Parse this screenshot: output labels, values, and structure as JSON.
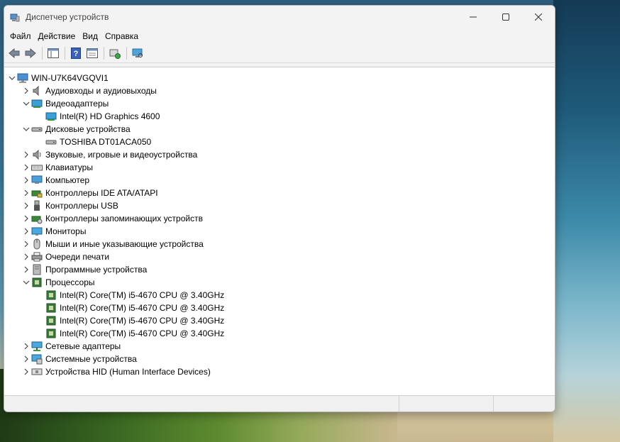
{
  "window": {
    "title": "Диспетчер устройств"
  },
  "menu": [
    "Файл",
    "Действие",
    "Вид",
    "Справка"
  ],
  "tree": {
    "root": "WIN-U7K64VGQVI1",
    "categories": [
      {
        "label": "Аудиовходы и аудиовыходы",
        "expanded": false,
        "icon": "speaker-icon",
        "children": []
      },
      {
        "label": "Видеоадаптеры",
        "expanded": true,
        "icon": "display-adapter-icon",
        "children": [
          "Intel(R) HD Graphics 4600"
        ]
      },
      {
        "label": "Дисковые устройства",
        "expanded": true,
        "icon": "disk-drive-icon",
        "children": [
          "TOSHIBA DT01ACA050"
        ]
      },
      {
        "label": "Звуковые, игровые и видеоустройства",
        "expanded": false,
        "icon": "sound-icon",
        "children": []
      },
      {
        "label": "Клавиатуры",
        "expanded": false,
        "icon": "keyboard-icon",
        "children": []
      },
      {
        "label": "Компьютер",
        "expanded": false,
        "icon": "computer-icon",
        "children": []
      },
      {
        "label": "Контроллеры IDE ATA/ATAPI",
        "expanded": false,
        "icon": "ide-controller-icon",
        "children": []
      },
      {
        "label": "Контроллеры USB",
        "expanded": false,
        "icon": "usb-icon",
        "children": []
      },
      {
        "label": "Контроллеры запоминающих устройств",
        "expanded": false,
        "icon": "storage-controller-icon",
        "children": []
      },
      {
        "label": "Мониторы",
        "expanded": false,
        "icon": "monitor-icon",
        "children": []
      },
      {
        "label": "Мыши и иные указывающие устройства",
        "expanded": false,
        "icon": "mouse-icon",
        "children": []
      },
      {
        "label": "Очереди печати",
        "expanded": false,
        "icon": "printer-icon",
        "children": []
      },
      {
        "label": "Программные устройства",
        "expanded": false,
        "icon": "software-device-icon",
        "children": []
      },
      {
        "label": "Процессоры",
        "expanded": true,
        "icon": "processor-icon",
        "children": [
          "Intel(R) Core(TM) i5-4670 CPU @ 3.40GHz",
          "Intel(R) Core(TM) i5-4670 CPU @ 3.40GHz",
          "Intel(R) Core(TM) i5-4670 CPU @ 3.40GHz",
          "Intel(R) Core(TM) i5-4670 CPU @ 3.40GHz"
        ]
      },
      {
        "label": "Сетевые адаптеры",
        "expanded": false,
        "icon": "network-icon",
        "children": []
      },
      {
        "label": "Системные устройства",
        "expanded": false,
        "icon": "system-device-icon",
        "children": []
      },
      {
        "label": "Устройства HID (Human Interface Devices)",
        "expanded": false,
        "icon": "hid-icon",
        "children": []
      }
    ]
  },
  "colors": {
    "selection": "#cce8ff",
    "window_bg": "#f3f3f3",
    "tree_bg": "#ffffff"
  }
}
